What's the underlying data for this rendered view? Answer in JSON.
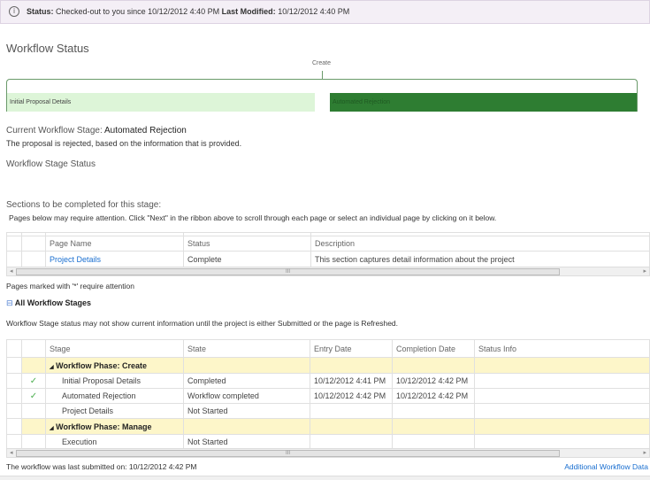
{
  "status_bar": {
    "status_label": "Status:",
    "status_text": "Checked-out to you since 10/12/2012 4:40 PM",
    "modified_label": "Last Modified:",
    "modified_text": "10/12/2012 4:40 PM"
  },
  "workflow_status": {
    "title": "Workflow Status",
    "marker_label": "Create",
    "stages": [
      {
        "label": "Initial Proposal Details",
        "state": "completed"
      },
      {
        "label": "Automated Rejection",
        "state": "current"
      }
    ]
  },
  "current_stage": {
    "prefix": "Current Workflow Stage:",
    "name": "Automated Rejection",
    "description": "The proposal is rejected, based on the information that is provided.",
    "stage_status_title": "Workflow Stage Status"
  },
  "sections": {
    "title": "Sections to be completed for this stage:",
    "hint": "Pages below may require attention. Click \"Next\" in the ribbon above to scroll through each page or select an individual page by clicking on it below.",
    "columns": [
      "Page Name",
      "Status",
      "Description"
    ],
    "rows": [
      {
        "page": "Project Details",
        "status": "Complete",
        "description": "This section captures detail information about the project"
      }
    ],
    "note": "Pages marked with '*' require attention"
  },
  "all_stages": {
    "title": "All Workflow Stages",
    "note": "Workflow Stage status may not show current information until the project is either Submitted or the page is Refreshed.",
    "columns": [
      "Stage",
      "State",
      "Entry Date",
      "Completion Date",
      "Status Info"
    ],
    "rows": [
      {
        "phase": true,
        "stage": "Workflow Phase: Create"
      },
      {
        "check": "✓",
        "stage": "Initial Proposal Details",
        "state": "Completed",
        "entry": "10/12/2012 4:41 PM",
        "completion": "10/12/2012 4:42 PM",
        "info": ""
      },
      {
        "check": "✓",
        "stage": "Automated Rejection",
        "state": "Workflow completed",
        "entry": "10/12/2012 4:42 PM",
        "completion": "10/12/2012 4:42 PM",
        "info": ""
      },
      {
        "check": "",
        "stage": "Project Details",
        "state": "Not Started",
        "entry": "",
        "completion": "",
        "info": ""
      },
      {
        "phase": true,
        "stage": "Workflow Phase: Manage"
      },
      {
        "check": "",
        "stage": "Execution",
        "state": "Not Started",
        "entry": "",
        "completion": "",
        "info": ""
      }
    ]
  },
  "footer": {
    "last_submitted": "The workflow was last submitted on: 10/12/2012 4:42 PM",
    "link": "Additional Workflow Data"
  },
  "colors": {
    "completed": "#ddf5d8",
    "current": "#2e7d32",
    "phase_row": "#fdf6c9",
    "link": "#1a6fd0"
  }
}
